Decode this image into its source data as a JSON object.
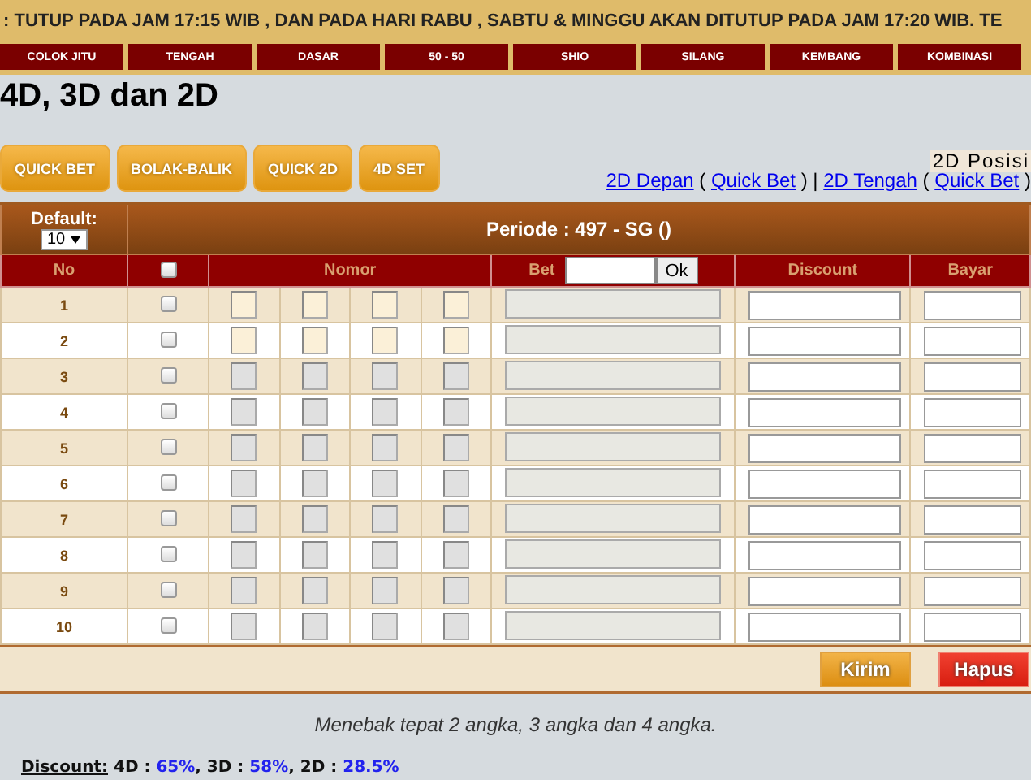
{
  "marquee": ": TUTUP PADA JAM 17:15 WIB , DAN PADA HARI RABU , SABTU & MINGGU AKAN DITUTUP PADA JAM 17:20 WIB. TE",
  "tabs": [
    {
      "label": "COLOK JITU",
      "selected": false
    },
    {
      "label": "TENGAH",
      "selected": false
    },
    {
      "label": "DASAR",
      "selected": false
    },
    {
      "label": "50 - 50",
      "selected": false
    },
    {
      "label": "SHIO",
      "selected": false
    },
    {
      "label": "SILANG",
      "selected": false
    },
    {
      "label": "KEMBANG",
      "selected": false
    },
    {
      "label": "KOMBINASI",
      "selected": false
    }
  ],
  "title": "4D, 3D dan 2D",
  "buttons": [
    "QUICK BET",
    "BOLAK-BALIK",
    "QUICK 2D",
    "4D SET"
  ],
  "posisi_label": "2D Posisi",
  "links": [
    {
      "kind": "link",
      "text": "2D Depan"
    },
    {
      "kind": "text",
      "text": " ( "
    },
    {
      "kind": "link",
      "text": "Quick Bet"
    },
    {
      "kind": "text",
      "text": " ) | "
    },
    {
      "kind": "link",
      "text": "2D Tengah"
    },
    {
      "kind": "text",
      "text": " ( "
    },
    {
      "kind": "link",
      "text": "Quick Bet"
    },
    {
      "kind": "text",
      "text": " )"
    }
  ],
  "table": {
    "default_label": "Default:",
    "default_value": "10",
    "periode": "Periode : 497 - SG ()",
    "columns": {
      "no": "No",
      "nomor": "Nomor",
      "bet": "Bet",
      "ok": "Ok",
      "discount": "Discount",
      "bayar": "Bayar"
    },
    "select_all_checked": false,
    "rows": [
      {
        "no": "1",
        "checked": false,
        "enabled": true
      },
      {
        "no": "2",
        "checked": false,
        "enabled": true
      },
      {
        "no": "3",
        "checked": false,
        "enabled": false
      },
      {
        "no": "4",
        "checked": false,
        "enabled": false
      },
      {
        "no": "5",
        "checked": false,
        "enabled": false
      },
      {
        "no": "6",
        "checked": false,
        "enabled": false
      },
      {
        "no": "7",
        "checked": false,
        "enabled": false
      },
      {
        "no": "8",
        "checked": false,
        "enabled": false
      },
      {
        "no": "9",
        "checked": false,
        "enabled": false
      },
      {
        "no": "10",
        "checked": false,
        "enabled": false
      }
    ],
    "submit": "Kirim",
    "clear": "Hapus"
  },
  "description": "Menebak tepat 2 angka, 3 angka dan 4 angka.",
  "discount": {
    "label": "Discount:",
    "items": [
      {
        "name": "4D :",
        "value": "65%",
        "after": ","
      },
      {
        "name": "3D :",
        "value": "58%",
        "after": ","
      },
      {
        "name": "2D :",
        "value": "28.5%"
      }
    ]
  }
}
